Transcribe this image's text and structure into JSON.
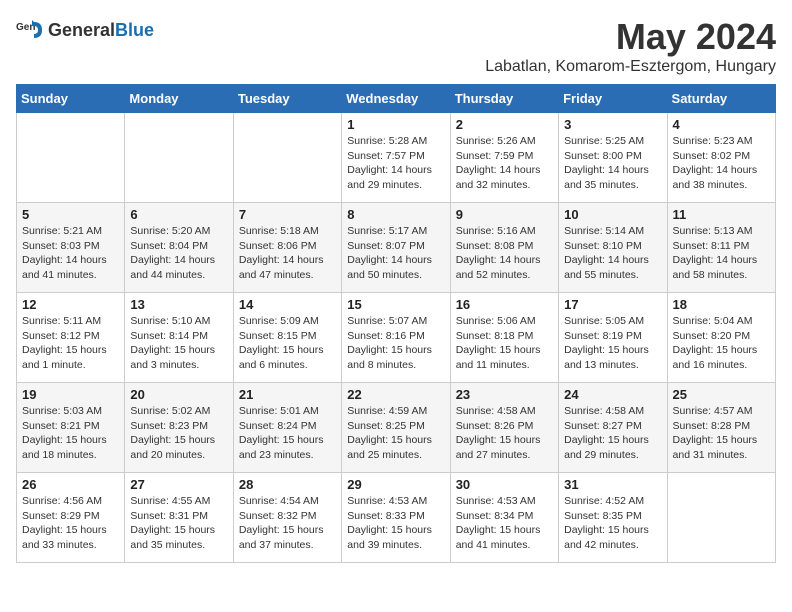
{
  "header": {
    "logo_general": "General",
    "logo_blue": "Blue",
    "title": "May 2024",
    "subtitle": "Labatlan, Komarom-Esztergom, Hungary"
  },
  "days_of_week": [
    "Sunday",
    "Monday",
    "Tuesday",
    "Wednesday",
    "Thursday",
    "Friday",
    "Saturday"
  ],
  "weeks": [
    [
      {
        "day": "",
        "info": ""
      },
      {
        "day": "",
        "info": ""
      },
      {
        "day": "",
        "info": ""
      },
      {
        "day": "1",
        "info": "Sunrise: 5:28 AM\nSunset: 7:57 PM\nDaylight: 14 hours\nand 29 minutes."
      },
      {
        "day": "2",
        "info": "Sunrise: 5:26 AM\nSunset: 7:59 PM\nDaylight: 14 hours\nand 32 minutes."
      },
      {
        "day": "3",
        "info": "Sunrise: 5:25 AM\nSunset: 8:00 PM\nDaylight: 14 hours\nand 35 minutes."
      },
      {
        "day": "4",
        "info": "Sunrise: 5:23 AM\nSunset: 8:02 PM\nDaylight: 14 hours\nand 38 minutes."
      }
    ],
    [
      {
        "day": "5",
        "info": "Sunrise: 5:21 AM\nSunset: 8:03 PM\nDaylight: 14 hours\nand 41 minutes."
      },
      {
        "day": "6",
        "info": "Sunrise: 5:20 AM\nSunset: 8:04 PM\nDaylight: 14 hours\nand 44 minutes."
      },
      {
        "day": "7",
        "info": "Sunrise: 5:18 AM\nSunset: 8:06 PM\nDaylight: 14 hours\nand 47 minutes."
      },
      {
        "day": "8",
        "info": "Sunrise: 5:17 AM\nSunset: 8:07 PM\nDaylight: 14 hours\nand 50 minutes."
      },
      {
        "day": "9",
        "info": "Sunrise: 5:16 AM\nSunset: 8:08 PM\nDaylight: 14 hours\nand 52 minutes."
      },
      {
        "day": "10",
        "info": "Sunrise: 5:14 AM\nSunset: 8:10 PM\nDaylight: 14 hours\nand 55 minutes."
      },
      {
        "day": "11",
        "info": "Sunrise: 5:13 AM\nSunset: 8:11 PM\nDaylight: 14 hours\nand 58 minutes."
      }
    ],
    [
      {
        "day": "12",
        "info": "Sunrise: 5:11 AM\nSunset: 8:12 PM\nDaylight: 15 hours\nand 1 minute."
      },
      {
        "day": "13",
        "info": "Sunrise: 5:10 AM\nSunset: 8:14 PM\nDaylight: 15 hours\nand 3 minutes."
      },
      {
        "day": "14",
        "info": "Sunrise: 5:09 AM\nSunset: 8:15 PM\nDaylight: 15 hours\nand 6 minutes."
      },
      {
        "day": "15",
        "info": "Sunrise: 5:07 AM\nSunset: 8:16 PM\nDaylight: 15 hours\nand 8 minutes."
      },
      {
        "day": "16",
        "info": "Sunrise: 5:06 AM\nSunset: 8:18 PM\nDaylight: 15 hours\nand 11 minutes."
      },
      {
        "day": "17",
        "info": "Sunrise: 5:05 AM\nSunset: 8:19 PM\nDaylight: 15 hours\nand 13 minutes."
      },
      {
        "day": "18",
        "info": "Sunrise: 5:04 AM\nSunset: 8:20 PM\nDaylight: 15 hours\nand 16 minutes."
      }
    ],
    [
      {
        "day": "19",
        "info": "Sunrise: 5:03 AM\nSunset: 8:21 PM\nDaylight: 15 hours\nand 18 minutes."
      },
      {
        "day": "20",
        "info": "Sunrise: 5:02 AM\nSunset: 8:23 PM\nDaylight: 15 hours\nand 20 minutes."
      },
      {
        "day": "21",
        "info": "Sunrise: 5:01 AM\nSunset: 8:24 PM\nDaylight: 15 hours\nand 23 minutes."
      },
      {
        "day": "22",
        "info": "Sunrise: 4:59 AM\nSunset: 8:25 PM\nDaylight: 15 hours\nand 25 minutes."
      },
      {
        "day": "23",
        "info": "Sunrise: 4:58 AM\nSunset: 8:26 PM\nDaylight: 15 hours\nand 27 minutes."
      },
      {
        "day": "24",
        "info": "Sunrise: 4:58 AM\nSunset: 8:27 PM\nDaylight: 15 hours\nand 29 minutes."
      },
      {
        "day": "25",
        "info": "Sunrise: 4:57 AM\nSunset: 8:28 PM\nDaylight: 15 hours\nand 31 minutes."
      }
    ],
    [
      {
        "day": "26",
        "info": "Sunrise: 4:56 AM\nSunset: 8:29 PM\nDaylight: 15 hours\nand 33 minutes."
      },
      {
        "day": "27",
        "info": "Sunrise: 4:55 AM\nSunset: 8:31 PM\nDaylight: 15 hours\nand 35 minutes."
      },
      {
        "day": "28",
        "info": "Sunrise: 4:54 AM\nSunset: 8:32 PM\nDaylight: 15 hours\nand 37 minutes."
      },
      {
        "day": "29",
        "info": "Sunrise: 4:53 AM\nSunset: 8:33 PM\nDaylight: 15 hours\nand 39 minutes."
      },
      {
        "day": "30",
        "info": "Sunrise: 4:53 AM\nSunset: 8:34 PM\nDaylight: 15 hours\nand 41 minutes."
      },
      {
        "day": "31",
        "info": "Sunrise: 4:52 AM\nSunset: 8:35 PM\nDaylight: 15 hours\nand 42 minutes."
      },
      {
        "day": "",
        "info": ""
      }
    ]
  ]
}
